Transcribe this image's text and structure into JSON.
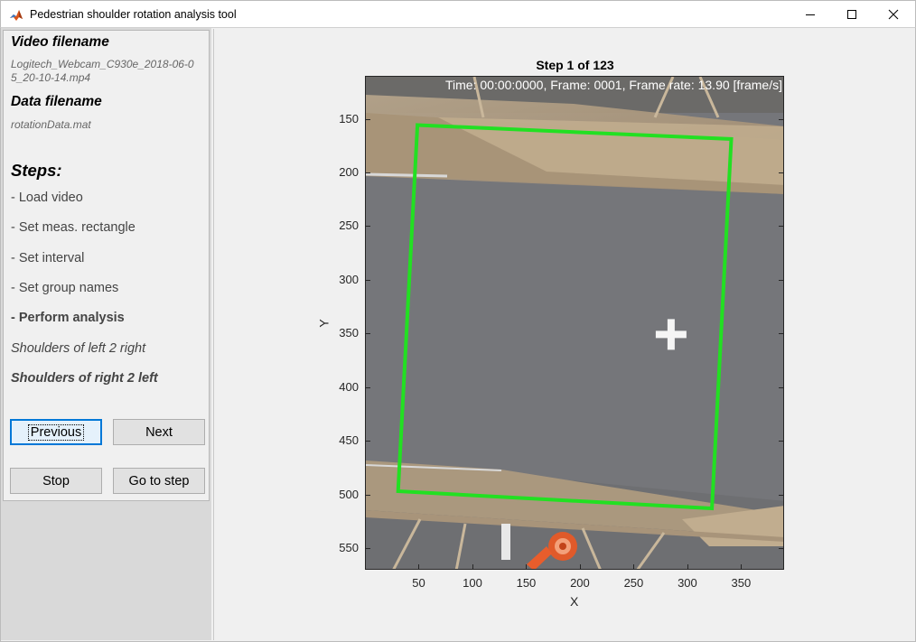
{
  "window": {
    "title": "Pedestrian shoulder rotation analysis tool"
  },
  "left_panel": {
    "video_header": "Video filename",
    "video_filename_line1": "Logitech_Webcam_C930e_2018-06-0",
    "video_filename_line2": "5_20-10-14.mp4",
    "data_header": "Data filename",
    "data_filename": "rotationData.mat",
    "steps_header": "Steps:",
    "steps": [
      "- Load video",
      "- Set meas. rectangle",
      "- Set interval",
      "- Set group names",
      "- Perform analysis",
      "Shoulders of left 2 right",
      "Shoulders of right 2 left"
    ],
    "buttons": {
      "previous": "Previous",
      "next": "Next",
      "stop": "Stop",
      "go_to_step": "Go to step"
    }
  },
  "plot": {
    "title": "Step 1 of 123",
    "overlay": "Time: 00:00:0000, Frame: 0001, Frame rate: 13.90 [frame/s]",
    "xlabel": "X",
    "ylabel": "Y",
    "xticks": [
      "50",
      "100",
      "150",
      "200",
      "250",
      "300",
      "350"
    ],
    "yticks": [
      "150",
      "200",
      "250",
      "300",
      "350",
      "400",
      "450",
      "500",
      "550"
    ],
    "xlim": [
      0,
      390
    ],
    "ylim": [
      110,
      570
    ],
    "rectangle_color": "#22e022",
    "measurement_rectangle": [
      [
        48,
        155
      ],
      [
        340,
        168
      ],
      [
        322,
        512
      ],
      [
        30,
        496
      ]
    ],
    "center_marker": [
      284,
      350
    ]
  }
}
